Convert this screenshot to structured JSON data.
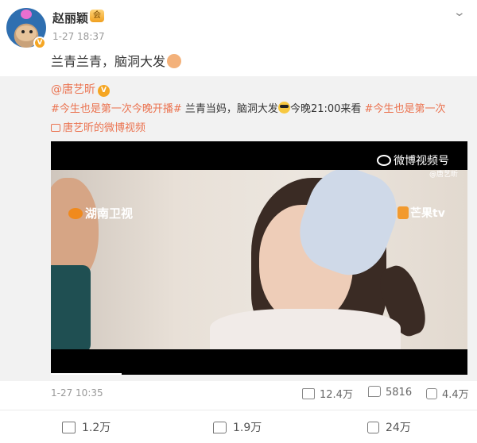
{
  "author": {
    "name": "赵丽颖",
    "time": "1-27 18:37",
    "verified_badge": "V",
    "vip_label": "会"
  },
  "post": {
    "text": "兰青兰青，脑洞大发"
  },
  "repost": {
    "author": "@唐艺昕",
    "verified_badge": "V",
    "hashtag_1": "#今生也是第一次今晚开播#",
    "text_mid_1": " 兰青当妈，脑洞大发",
    "text_mid_2": "今晚21:00来看 ",
    "hashtag_2": "#今生也是第一次",
    "video_link": "唐艺昕的微博视频",
    "date": "1-27 10:35",
    "stats": {
      "reposts": "12.4万",
      "comments": "5816",
      "likes": "4.4万"
    },
    "video": {
      "watermark_weibo": "微博视频号",
      "watermark_handle": "@唐艺昕",
      "watermark_hunan": "湖南卫视",
      "watermark_mango": "芒果tv",
      "progress": 0.17
    }
  },
  "actions": {
    "repost": "1.2万",
    "comment": "1.9万",
    "like": "24万"
  },
  "colors": {
    "link": "#eb7350",
    "repost_bg": "#f2f2f2",
    "badge": "#f5a623"
  }
}
